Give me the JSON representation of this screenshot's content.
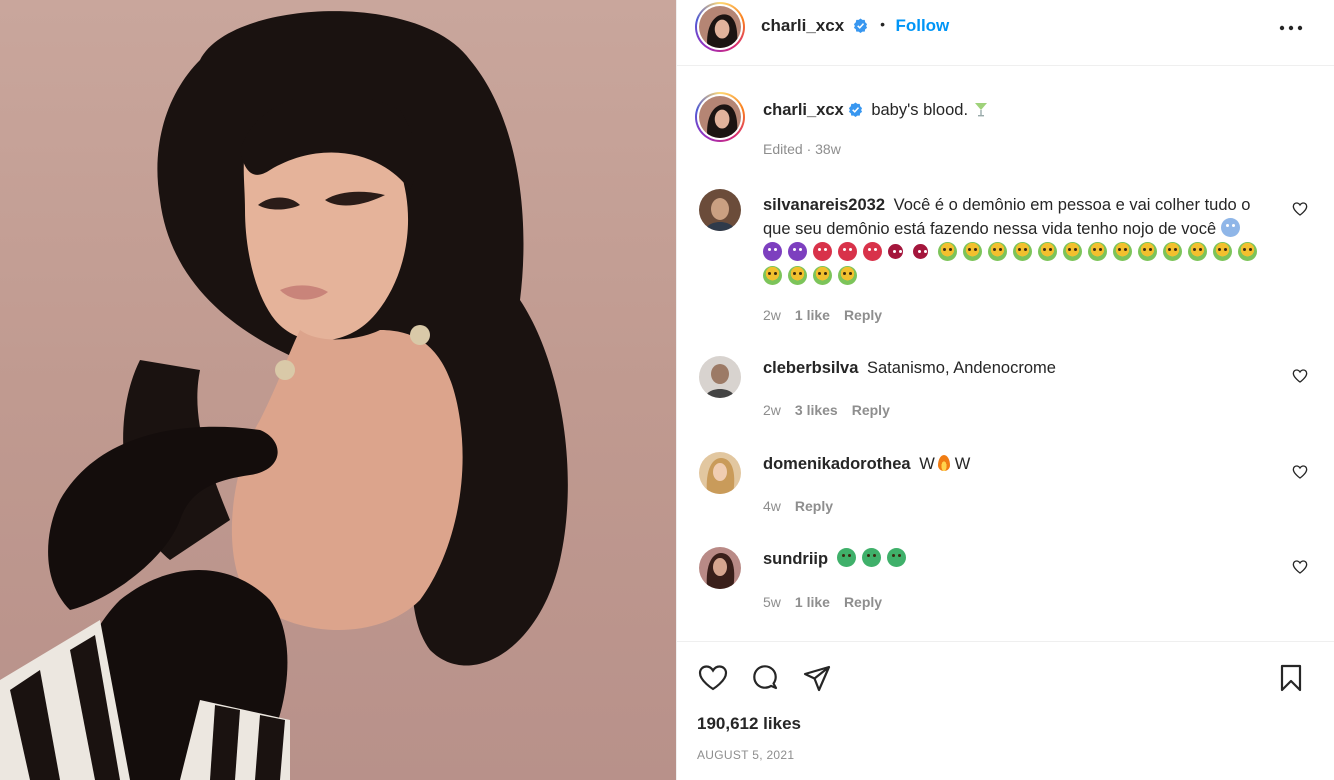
{
  "post": {
    "image_alt": "Portrait photo of charli_xcx with voluminous dark hair and black opera gloves",
    "author": "charli_xcx",
    "verified": true,
    "follow_label": "Follow",
    "separator": "•",
    "caption": "baby's blood.",
    "caption_meta": "Edited · 38w",
    "likes": "190,612 likes",
    "date": "AUGUST 5, 2021"
  },
  "comments": [
    {
      "username": "silvanareis2032",
      "text": "Você é o demônio em pessoa e vai colher tudo o que seu demônio está fazendo nessa vida tenho nojo de você",
      "emoji_sequence": [
        "ghost",
        "purple-devil",
        "purple-devil",
        "red-ogre",
        "red-ogre",
        "red-ogre",
        "devil-face",
        "devil-face",
        "nauseated",
        "nauseated",
        "nauseated",
        "nauseated",
        "nauseated",
        "nauseated",
        "nauseated",
        "nauseated",
        "nauseated",
        "nauseated",
        "nauseated",
        "nauseated",
        "nauseated",
        "nauseated",
        "nauseated",
        "nauseated",
        "nauseated"
      ],
      "age": "2w",
      "likes": "1 like",
      "reply": "Reply"
    },
    {
      "username": "cleberbsilva",
      "text": "Satanismo, Andenocrome",
      "age": "2w",
      "likes": "3 likes",
      "reply": "Reply"
    },
    {
      "username": "domenikadorothea",
      "text_before": "W",
      "text_after": "W",
      "emoji": "fire",
      "age": "4w",
      "reply": "Reply"
    },
    {
      "username": "sundriip",
      "emoji_sequence": [
        "nauseated-green",
        "nauseated-green",
        "nauseated-green"
      ],
      "age": "5w",
      "likes": "1 like",
      "reply": "Reply"
    }
  ],
  "icons": {
    "more": "more-horizontal-icon",
    "like": "heart-icon",
    "comment": "comment-icon",
    "share": "paper-plane-icon",
    "save": "bookmark-icon",
    "verified": "verified-badge-icon"
  },
  "colors": {
    "follow_blue": "#0095f6",
    "verified_blue": "#3897f0",
    "text_primary": "#262626",
    "text_secondary": "#8e8e8e",
    "divider": "#efefef"
  }
}
